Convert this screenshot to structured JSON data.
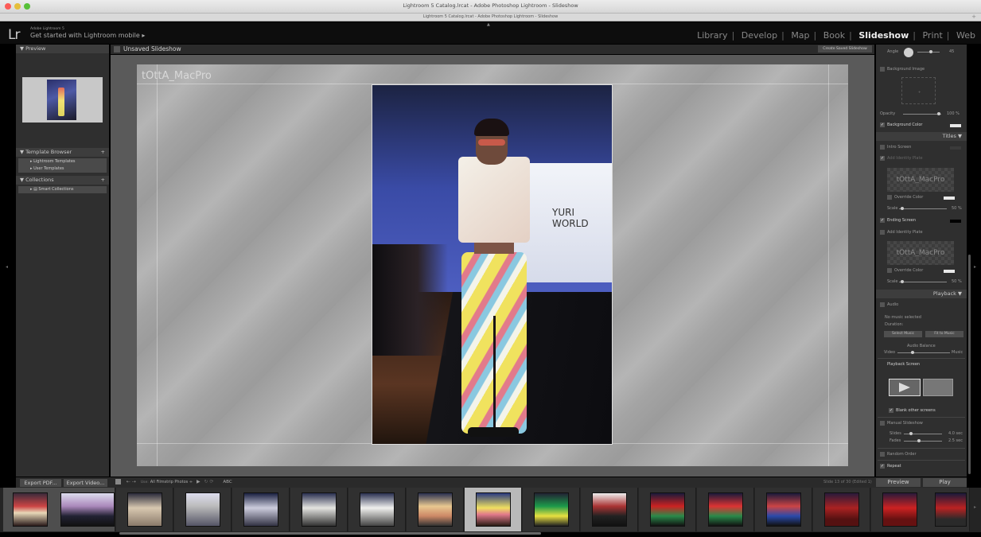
{
  "window": {
    "title": "Lightroom 5 Catalog.lrcat - Adobe Photoshop Lightroom - Slideshow",
    "subtitle": "Lightroom 5 Catalog.lrcat - Adobe Photoshop Lightroom - Slideshow",
    "traffic_colors": [
      "#fc5b57",
      "#e5bf3c",
      "#57c038"
    ]
  },
  "identity": {
    "logo": "Lr",
    "small": "Adobe Lightroom 5",
    "main": "Get started with Lightroom mobile  ▸"
  },
  "modules": [
    "Library",
    "Develop",
    "Map",
    "Book",
    "Slideshow",
    "Print",
    "Web"
  ],
  "active_module": "Slideshow",
  "left_panel": {
    "preview_header": "▼  Preview",
    "template_header": "▼  Template Browser",
    "template_items": [
      "▸  Lightroom Templates",
      "▸  User Templates"
    ],
    "collections_header": "▼  Collections",
    "collection_items": [
      "▸  ▤  Smart Collections"
    ],
    "plus": "+"
  },
  "center": {
    "title": "Unsaved Slideshow",
    "create_saved": "Create Saved Slideshow",
    "identity_plate": "tOttA_MacPro",
    "screen_text": "YURI WORLD"
  },
  "right_panel": {
    "angle_label": "Angle",
    "angle_value": "45",
    "background_image": "Background Image",
    "opacity_label": "Opacity",
    "opacity_value": "100 %",
    "background_color": "Background Color",
    "titles_header": "Titles  ▼",
    "intro_screen": "Intro Screen",
    "add_identity_plate_1": "Add Identity Plate",
    "plate_text": "tOttA_MacPro",
    "override_color_1": "Override Color",
    "scale_label_1": "Scale",
    "scale_value_1": "50 %",
    "ending_screen": "Ending Screen",
    "add_identity_plate_2": "Add Identity Plate",
    "override_color_2": "Override Color",
    "scale_label_2": "Scale",
    "scale_value_2": "50 %",
    "playback_header": "Playback  ▼",
    "audio": "Audio",
    "no_music": "No music selected",
    "duration": "Duration:",
    "select_music": "Select Music",
    "fit_to_music": "Fit to Music",
    "audio_balance": "Audio Balance",
    "video_label": "Video",
    "music_label": "Music",
    "playback_screen": "Playback Screen",
    "blank_other": "Blank other screens",
    "manual_slideshow": "Manual Slideshow",
    "slides_label": "Slides",
    "slides_value": "4.0 sec",
    "fades_label": "Fades",
    "fades_value": "2.5 sec",
    "random_order": "Random Order",
    "repeat": "Repeat",
    "check": "✓"
  },
  "bottom": {
    "export_pdf": "Export PDF...",
    "export_video": "Export Video...",
    "use_label": "Use:",
    "use_value": "All Filmstrip Photos  ÷",
    "abc": "ABC",
    "slide_count": "Slide 13 of 30 (Edited 1)",
    "preview": "Preview",
    "play": "Play"
  },
  "colors": {
    "accent_white": "#eeeeee",
    "panel_bg": "#2f2f2f",
    "header_bg": "#3d3d3d"
  }
}
